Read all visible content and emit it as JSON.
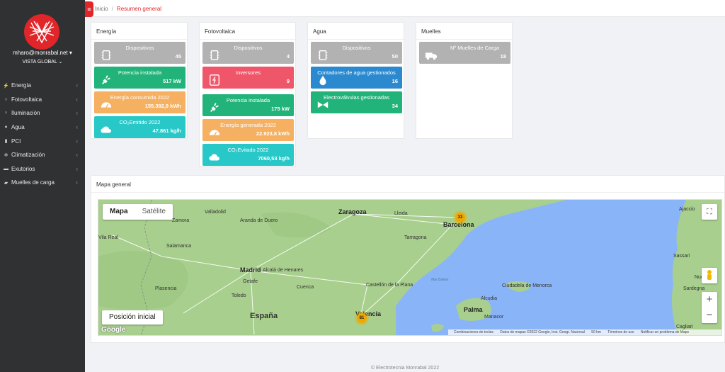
{
  "user": {
    "email": "mharo@monrabal.net",
    "view": "VISTA GLOBAL"
  },
  "sidebar": {
    "items": [
      {
        "label": "Energía",
        "icon": "bolt-icon"
      },
      {
        "label": "Fotovoltaica",
        "icon": "sun-icon"
      },
      {
        "label": "Iluminación",
        "icon": "bulb-icon"
      },
      {
        "label": "Agua",
        "icon": "drop-icon"
      },
      {
        "label": "PCI",
        "icon": "extinguisher-icon"
      },
      {
        "label": "Climatización",
        "icon": "snowflake-icon"
      },
      {
        "label": "Exutorios",
        "icon": "vent-icon"
      },
      {
        "label": "Muelles de carga",
        "icon": "truck-icon"
      }
    ]
  },
  "breadcrumb": {
    "home": "Inicio",
    "current": "Resumen general"
  },
  "panels": {
    "energia": {
      "title": "Energía",
      "cards": [
        {
          "label": "Dispositivos",
          "value": "45",
          "color": "#b2b2b2",
          "icon": "chip-icon"
        },
        {
          "label": "Potencia instalada",
          "value": "517 kW",
          "color": "#21b37a",
          "icon": "plug-icon"
        },
        {
          "label": "Energía consumida 2022",
          "value": "155.392,9 kWh",
          "color": "#f5b061",
          "icon": "gauge-icon"
        },
        {
          "label": "CO₂Emitido 2022",
          "value": "47.861 kg/h",
          "color": "#28c8c8",
          "icon": "cloud-icon"
        }
      ]
    },
    "fotovoltaica": {
      "title": "Fotovoltaica",
      "cards": [
        {
          "label": "Dispositivos",
          "value": "4",
          "color": "#b2b2b2",
          "icon": "chip-icon"
        },
        {
          "label": "Inversores",
          "value": "9",
          "color": "#f0566a",
          "icon": "inverter-icon"
        },
        {
          "label": "Potencia instalada",
          "value": "175 kW",
          "color": "#21b37a",
          "icon": "plug-icon"
        },
        {
          "label": "Energía generada 2022",
          "value": "22.923,8 kWh",
          "color": "#f5b061",
          "icon": "gauge-icon"
        },
        {
          "label": "CO₂Evitado 2022",
          "value": "7060,53 kg/h",
          "color": "#28c8c8",
          "icon": "cloud-icon"
        }
      ]
    },
    "agua": {
      "title": "Agua",
      "cards": [
        {
          "label": "Dispositivos",
          "value": "50",
          "color": "#b2b2b2",
          "icon": "chip-icon"
        },
        {
          "label": "Contadores de agua gestionados",
          "value": "16",
          "color": "#2b89cf",
          "icon": "drop-icon"
        },
        {
          "label": "Electroválvulas gestionadas",
          "value": "34",
          "color": "#21b37a",
          "icon": "valve-icon"
        }
      ]
    },
    "muelles": {
      "title": "Muelles",
      "cards": [
        {
          "label": "Nº Muelles de Carga",
          "value": "18",
          "color": "#b2b2b2",
          "icon": "truck-icon"
        }
      ]
    }
  },
  "map_panel": {
    "title": "Mapa general",
    "map_type_options": [
      "Mapa",
      "Satélite"
    ],
    "position_button": "Posición inicial",
    "clusters": [
      "33",
      "81"
    ],
    "cities": [
      "Valladolid",
      "Zaragoza",
      "Lleida",
      "Barcelona",
      "Tarragona",
      "Zamora",
      "Aranda de Duero",
      "Salamanca",
      "Madrid",
      "Alcalá de Henares",
      "Getafe",
      "Toledo",
      "Cuenca",
      "Castellón de la Plana",
      "Valencia",
      "Palma",
      "Ciudadela de Menorca",
      "Alcudia",
      "Manacor",
      "Plasencia",
      "Sassari",
      "Nuoro",
      "Sardegna",
      "Ajaccio",
      "Cagliari",
      "Vila Real",
      "Mar Balear"
    ],
    "country_label": "España",
    "attribution": [
      "Combinaciones de teclas",
      "Datos de mapas ©2022 Google, Inst. Geogr. Nacional",
      "50 km",
      "Términos de uso",
      "Notificar un problema de Maps"
    ],
    "google_label": "Google"
  },
  "footer": "© Electrotecnia Monrabal 2022"
}
